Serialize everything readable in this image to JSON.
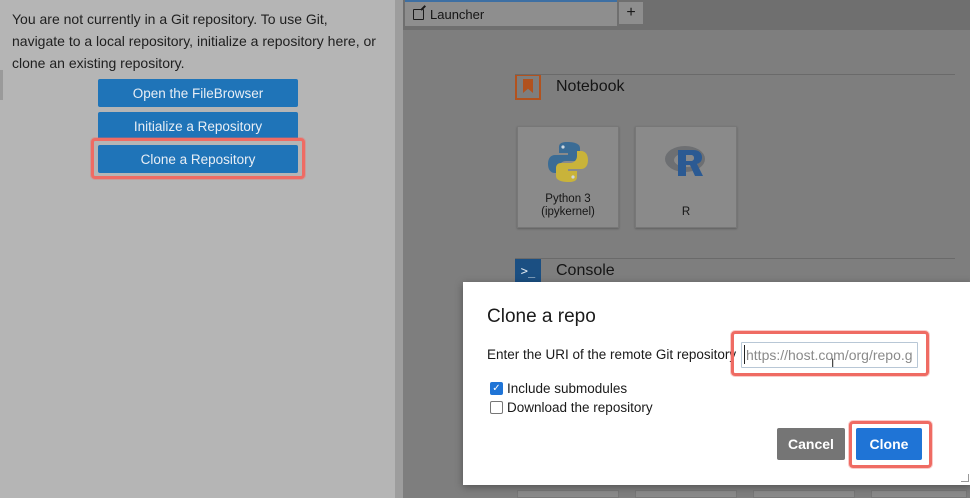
{
  "git_panel": {
    "message": "You are not currently in a Git repository. To use Git, navigate to a local repository, initialize a repository here, or clone an existing repository.",
    "buttons": [
      {
        "label": "Open the FileBrowser"
      },
      {
        "label": "Initialize a Repository"
      },
      {
        "label": "Clone a Repository"
      }
    ]
  },
  "tabs": {
    "items": [
      {
        "label": "Launcher",
        "icon": "launcher-icon"
      }
    ],
    "add_icon": "+"
  },
  "launcher": {
    "sections": [
      {
        "title": "Notebook",
        "icon": "notebook-icon"
      },
      {
        "title": "Console",
        "icon": "console-icon",
        "icon_glyph": ">_"
      }
    ],
    "kernels": [
      {
        "label": "Python 3\n(ipykernel)",
        "icon": "python-logo"
      },
      {
        "label": "R",
        "icon": "r-logo"
      }
    ]
  },
  "dialog": {
    "title": "Clone a repo",
    "uri_label": "Enter the URI of the remote Git repository",
    "uri_placeholder": "https://host.com/org/repo.git",
    "uri_value": "",
    "options": [
      {
        "label": "Include submodules",
        "checked": true
      },
      {
        "label": "Download the repository",
        "checked": false
      }
    ],
    "cancel_label": "Cancel",
    "clone_label": "Clone"
  },
  "colors": {
    "accent": "#1f74d6",
    "highlight": "#ef6b63",
    "git_button": "#1f74b8",
    "cancel": "#757575"
  }
}
